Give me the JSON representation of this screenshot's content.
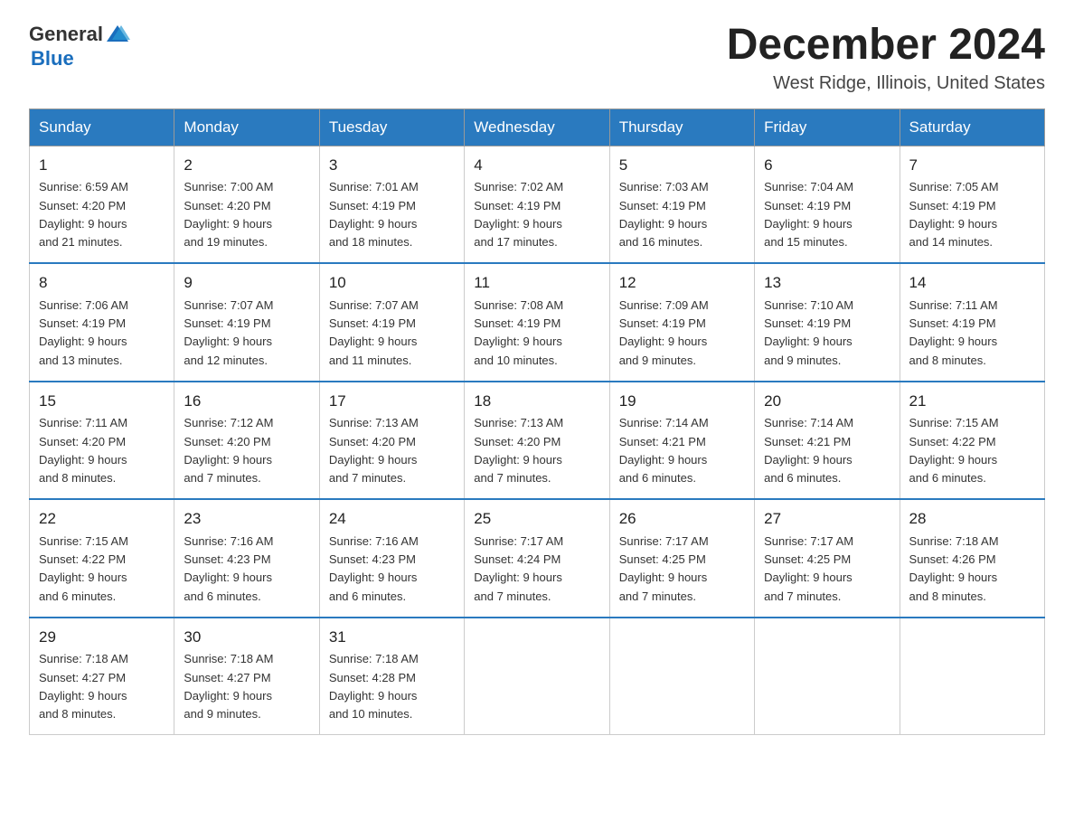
{
  "header": {
    "logo_general": "General",
    "logo_blue": "Blue",
    "title": "December 2024",
    "subtitle": "West Ridge, Illinois, United States"
  },
  "calendar": {
    "days_of_week": [
      "Sunday",
      "Monday",
      "Tuesday",
      "Wednesday",
      "Thursday",
      "Friday",
      "Saturday"
    ],
    "weeks": [
      [
        {
          "day": "1",
          "sunrise": "6:59 AM",
          "sunset": "4:20 PM",
          "daylight": "9 hours and 21 minutes."
        },
        {
          "day": "2",
          "sunrise": "7:00 AM",
          "sunset": "4:20 PM",
          "daylight": "9 hours and 19 minutes."
        },
        {
          "day": "3",
          "sunrise": "7:01 AM",
          "sunset": "4:19 PM",
          "daylight": "9 hours and 18 minutes."
        },
        {
          "day": "4",
          "sunrise": "7:02 AM",
          "sunset": "4:19 PM",
          "daylight": "9 hours and 17 minutes."
        },
        {
          "day": "5",
          "sunrise": "7:03 AM",
          "sunset": "4:19 PM",
          "daylight": "9 hours and 16 minutes."
        },
        {
          "day": "6",
          "sunrise": "7:04 AM",
          "sunset": "4:19 PM",
          "daylight": "9 hours and 15 minutes."
        },
        {
          "day": "7",
          "sunrise": "7:05 AM",
          "sunset": "4:19 PM",
          "daylight": "9 hours and 14 minutes."
        }
      ],
      [
        {
          "day": "8",
          "sunrise": "7:06 AM",
          "sunset": "4:19 PM",
          "daylight": "9 hours and 13 minutes."
        },
        {
          "day": "9",
          "sunrise": "7:07 AM",
          "sunset": "4:19 PM",
          "daylight": "9 hours and 12 minutes."
        },
        {
          "day": "10",
          "sunrise": "7:07 AM",
          "sunset": "4:19 PM",
          "daylight": "9 hours and 11 minutes."
        },
        {
          "day": "11",
          "sunrise": "7:08 AM",
          "sunset": "4:19 PM",
          "daylight": "9 hours and 10 minutes."
        },
        {
          "day": "12",
          "sunrise": "7:09 AM",
          "sunset": "4:19 PM",
          "daylight": "9 hours and 9 minutes."
        },
        {
          "day": "13",
          "sunrise": "7:10 AM",
          "sunset": "4:19 PM",
          "daylight": "9 hours and 9 minutes."
        },
        {
          "day": "14",
          "sunrise": "7:11 AM",
          "sunset": "4:19 PM",
          "daylight": "9 hours and 8 minutes."
        }
      ],
      [
        {
          "day": "15",
          "sunrise": "7:11 AM",
          "sunset": "4:20 PM",
          "daylight": "9 hours and 8 minutes."
        },
        {
          "day": "16",
          "sunrise": "7:12 AM",
          "sunset": "4:20 PM",
          "daylight": "9 hours and 7 minutes."
        },
        {
          "day": "17",
          "sunrise": "7:13 AM",
          "sunset": "4:20 PM",
          "daylight": "9 hours and 7 minutes."
        },
        {
          "day": "18",
          "sunrise": "7:13 AM",
          "sunset": "4:20 PM",
          "daylight": "9 hours and 7 minutes."
        },
        {
          "day": "19",
          "sunrise": "7:14 AM",
          "sunset": "4:21 PM",
          "daylight": "9 hours and 6 minutes."
        },
        {
          "day": "20",
          "sunrise": "7:14 AM",
          "sunset": "4:21 PM",
          "daylight": "9 hours and 6 minutes."
        },
        {
          "day": "21",
          "sunrise": "7:15 AM",
          "sunset": "4:22 PM",
          "daylight": "9 hours and 6 minutes."
        }
      ],
      [
        {
          "day": "22",
          "sunrise": "7:15 AM",
          "sunset": "4:22 PM",
          "daylight": "9 hours and 6 minutes."
        },
        {
          "day": "23",
          "sunrise": "7:16 AM",
          "sunset": "4:23 PM",
          "daylight": "9 hours and 6 minutes."
        },
        {
          "day": "24",
          "sunrise": "7:16 AM",
          "sunset": "4:23 PM",
          "daylight": "9 hours and 6 minutes."
        },
        {
          "day": "25",
          "sunrise": "7:17 AM",
          "sunset": "4:24 PM",
          "daylight": "9 hours and 7 minutes."
        },
        {
          "day": "26",
          "sunrise": "7:17 AM",
          "sunset": "4:25 PM",
          "daylight": "9 hours and 7 minutes."
        },
        {
          "day": "27",
          "sunrise": "7:17 AM",
          "sunset": "4:25 PM",
          "daylight": "9 hours and 7 minutes."
        },
        {
          "day": "28",
          "sunrise": "7:18 AM",
          "sunset": "4:26 PM",
          "daylight": "9 hours and 8 minutes."
        }
      ],
      [
        {
          "day": "29",
          "sunrise": "7:18 AM",
          "sunset": "4:27 PM",
          "daylight": "9 hours and 8 minutes."
        },
        {
          "day": "30",
          "sunrise": "7:18 AM",
          "sunset": "4:27 PM",
          "daylight": "9 hours and 9 minutes."
        },
        {
          "day": "31",
          "sunrise": "7:18 AM",
          "sunset": "4:28 PM",
          "daylight": "9 hours and 10 minutes."
        },
        null,
        null,
        null,
        null
      ]
    ],
    "sunrise_label": "Sunrise:",
    "sunset_label": "Sunset:",
    "daylight_label": "Daylight:"
  },
  "colors": {
    "header_bg": "#2a7abf",
    "header_text": "#ffffff",
    "border_top": "#2a7abf"
  }
}
